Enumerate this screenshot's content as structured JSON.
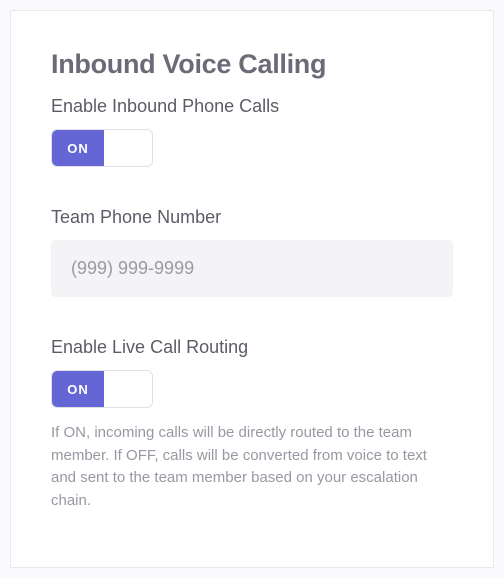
{
  "title": "Inbound Voice Calling",
  "enable_calls": {
    "label": "Enable Inbound Phone Calls",
    "toggle_text": "ON"
  },
  "phone": {
    "label": "Team Phone Number",
    "placeholder": "(999) 999-9999",
    "value": ""
  },
  "live_routing": {
    "label": "Enable Live Call Routing",
    "toggle_text": "ON",
    "help": "If ON, incoming calls will be directly routed to the team member. If OFF, calls will be converted from voice to text and sent to the team member based on your escalation chain."
  }
}
